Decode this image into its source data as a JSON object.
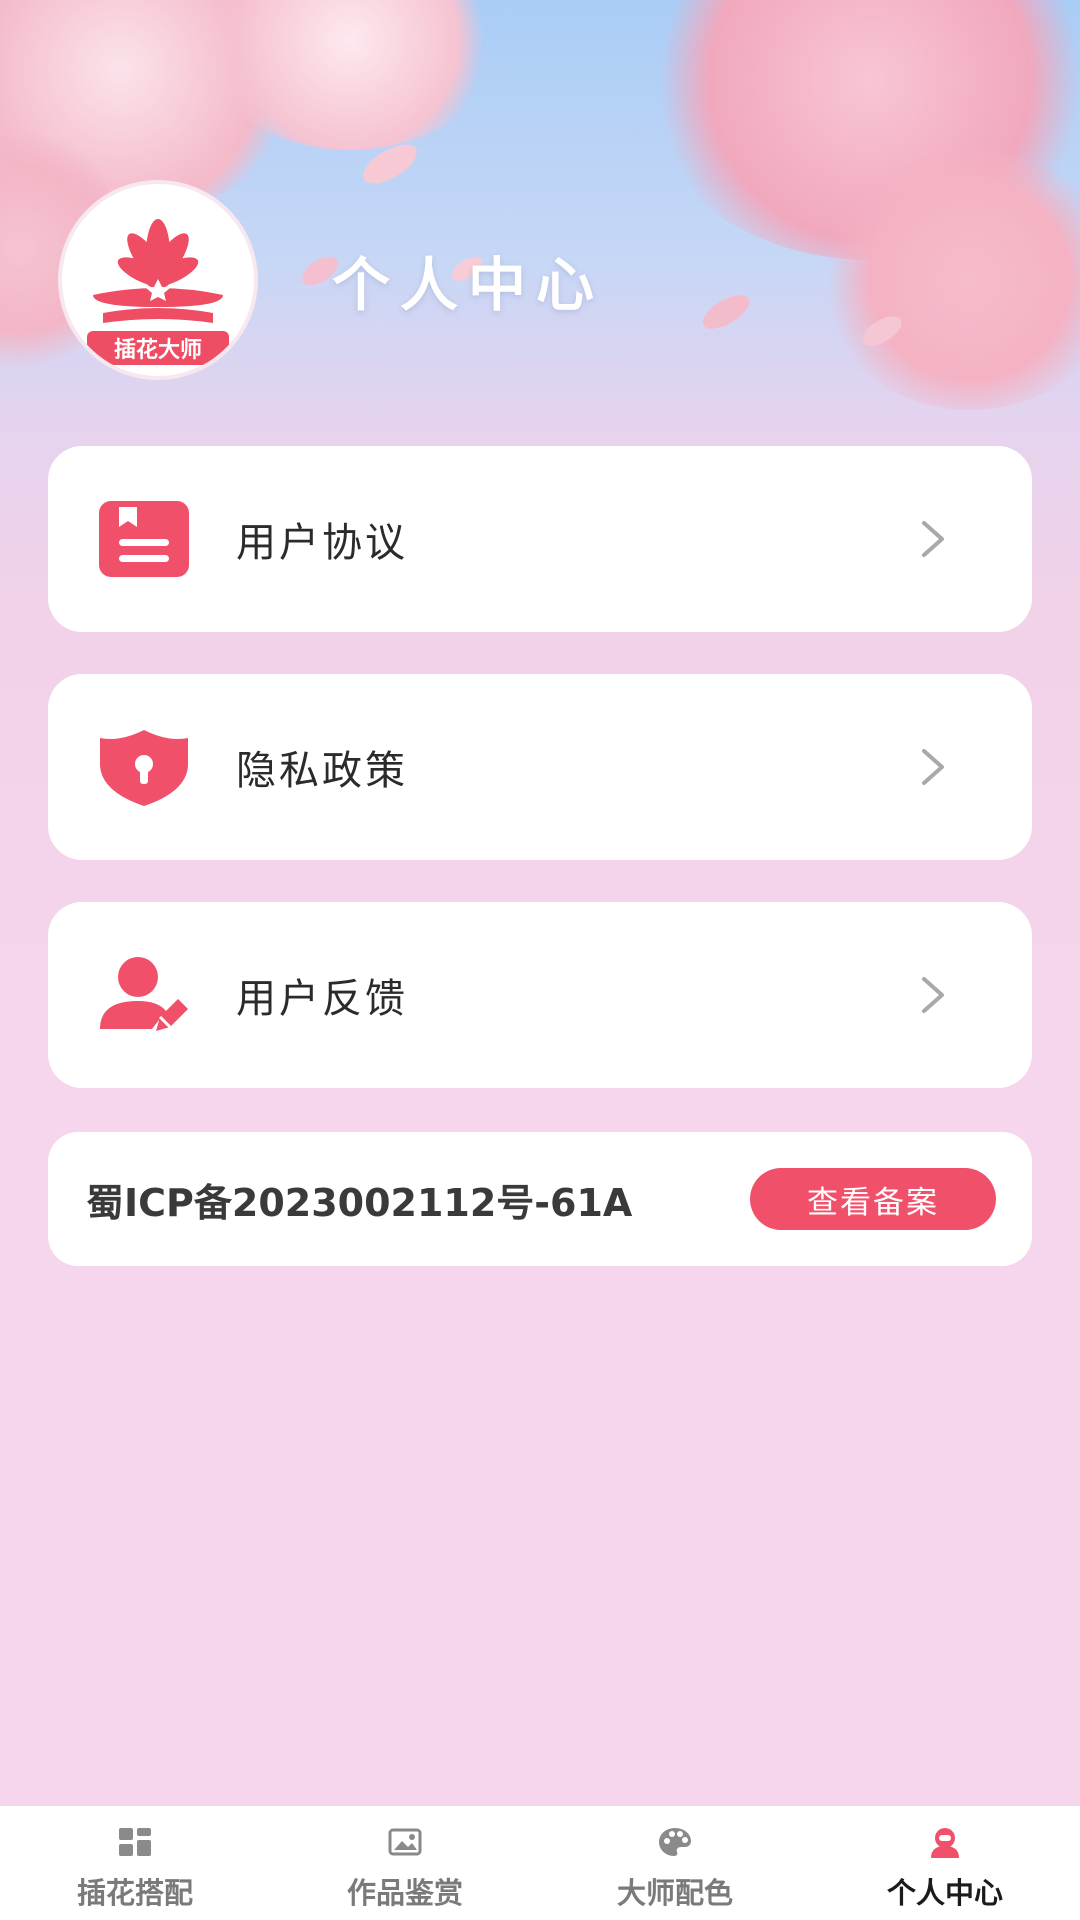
{
  "header": {
    "title": "个人中心",
    "avatar_logo_text": "插花大师"
  },
  "menu": [
    {
      "label": "用户协议",
      "icon": "document-icon"
    },
    {
      "label": "隐私政策",
      "icon": "shield-lock-icon"
    },
    {
      "label": "用户反馈",
      "icon": "user-edit-icon"
    }
  ],
  "icp": {
    "text": "蜀ICP备2023002112号-61A",
    "button_label": "查看备案"
  },
  "tabs": [
    {
      "label": "插花搭配",
      "icon": "dashboard-icon",
      "active": false
    },
    {
      "label": "作品鉴赏",
      "icon": "image-icon",
      "active": false
    },
    {
      "label": "大师配色",
      "icon": "palette-icon",
      "active": false
    },
    {
      "label": "个人中心",
      "icon": "person-icon",
      "active": true
    }
  ],
  "colors": {
    "accent": "#f0506a",
    "card_bg": "#ffffff",
    "page_bg": "#f5d6ec",
    "text_primary": "#2b2b2b",
    "tab_inactive": "#7a7a7a"
  }
}
